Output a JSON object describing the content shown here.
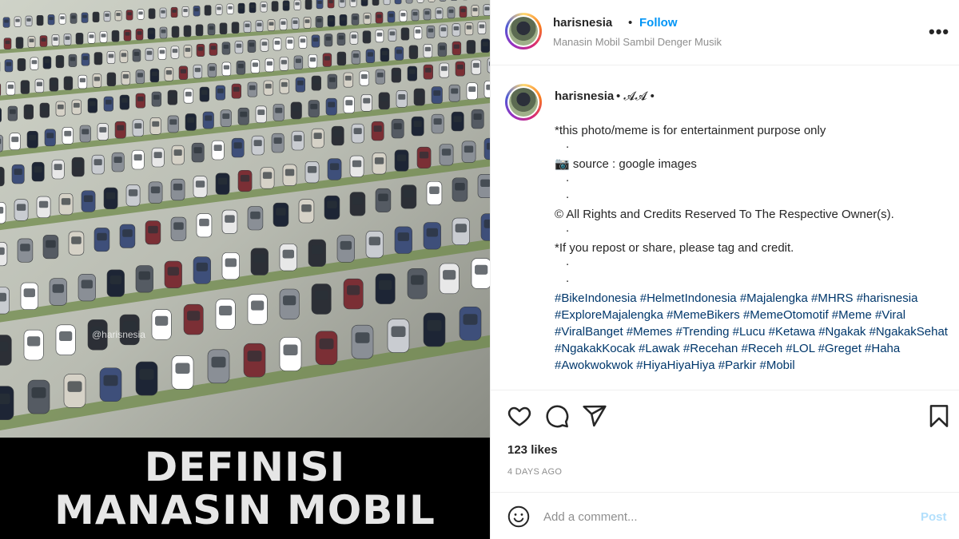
{
  "meme": {
    "watermark": "@harisnesia",
    "caption_line1": "DEFINISI",
    "caption_line2": "MANASIN MOBIL"
  },
  "header": {
    "username": "harisnesia",
    "separator": "•",
    "follow_label": "Follow",
    "subtitle": "Manasin Mobil Sambil Denger Musik",
    "more_label": "•••",
    "icons": {
      "more": "more-options-icon"
    }
  },
  "post_comment": {
    "username": "harisnesia",
    "meta": "• 𝓐𝓐 •",
    "lines": {
      "disclaimer": "*this photo/meme is for entertainment purpose only",
      "dot": ".",
      "source": "📷 source : google images",
      "rights": "© All Rights and Credits Reserved To The Respective Owner(s).",
      "repost": "*If you repost or share, please tag and credit.",
      "hashtags": "#BikeIndonesia #HelmetIndonesia #Majalengka #MHRS #harisnesia #ExploreMajalengka #MemeBikers #MemeOtomotif #Meme #Viral #ViralBanget #Memes #Trending #Lucu #Ketawa #Ngakak #NgakakSehat #NgakakKocak #Lawak #Recehan #Receh #LOL #Greget #Haha #Awokwokwok #HiyaHiyaHiya #Parkir #Mobil"
    }
  },
  "actions": {
    "likes": "123 likes",
    "time": "4 DAYS AGO",
    "icons": [
      "heart-icon",
      "comment-icon",
      "share-icon",
      "bookmark-icon"
    ]
  },
  "comment_bar": {
    "placeholder": "Add a comment...",
    "post_label": "Post",
    "icons": {
      "emoji": "emoji-icon"
    }
  },
  "colors": {
    "link_blue": "#0095f6",
    "hashtag_blue": "#00376b",
    "post_disabled": "#b2dffc",
    "muted": "#8e8e8e"
  }
}
